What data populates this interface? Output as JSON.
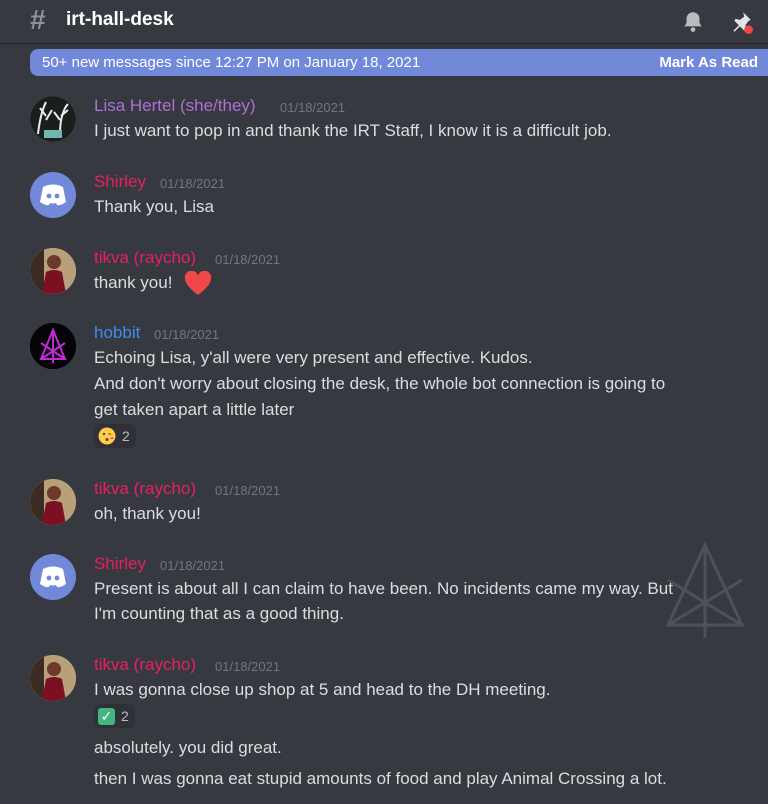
{
  "header": {
    "hash_glyph": "#",
    "channel_name": "irt-hall-desk",
    "bell_icon": "bell-icon",
    "pin_icon": "pin-icon"
  },
  "banner": {
    "text": "50+ new messages since 12:27 PM on January 18, 2021",
    "mark_read": "Mark As Read"
  },
  "colors": {
    "background": "#36393f",
    "banner": "#7289da",
    "name_purple": "#b06fd6",
    "name_pink": "#e91e63",
    "name_blue": "#3f8cf0",
    "heart": "#f04747"
  },
  "messages": [
    {
      "author": "Lisa Hertel (she/they)",
      "timestamp": "01/18/2021",
      "lines": [
        "I just want to pop in and thank the IRT Staff, I know it is a difficult job."
      ]
    },
    {
      "author": "Shirley",
      "timestamp": "01/18/2021",
      "lines": [
        "Thank you, Lisa"
      ]
    },
    {
      "author": "tikva (raycho)",
      "timestamp": "01/18/2021",
      "lines": [
        "thank you!"
      ],
      "emoji": "heart"
    },
    {
      "author": "hobbit",
      "timestamp": "01/18/2021",
      "lines": [
        "Echoing Lisa, y'all were very present and effective.  Kudos.",
        "And don't worry about closing the desk, the whole bot connection is going to",
        "get taken apart a little later"
      ],
      "reaction": {
        "emoji": "kissing-face",
        "count": "2"
      }
    },
    {
      "author": "tikva (raycho)",
      "timestamp": "01/18/2021",
      "lines": [
        "oh, thank you!"
      ]
    },
    {
      "author": "Shirley",
      "timestamp": "01/18/2021",
      "lines": [
        "Present is about all I can claim to have been. No incidents came my way. But",
        "I'm counting that as a good thing."
      ]
    },
    {
      "author": "tikva (raycho)",
      "timestamp": "01/18/2021",
      "lines": [
        "I was gonna close up shop at 5 and head to the DH meeting.",
        "absolutely. you did great.",
        "then I was gonna eat stupid amounts of food and play Animal Crossing a lot."
      ],
      "reaction": {
        "emoji": "check-mark",
        "count": "2"
      }
    }
  ]
}
